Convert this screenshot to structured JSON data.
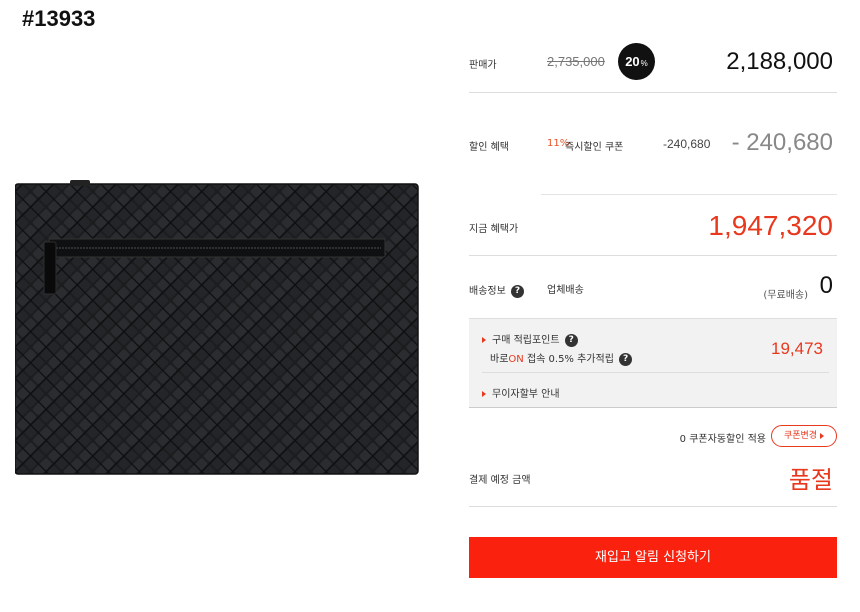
{
  "product": {
    "code": "#13933"
  },
  "price": {
    "label": "판매가",
    "original": "2,735,000",
    "discount_rate": "20",
    "discount_unit": "%",
    "sale_price": "2,188,000"
  },
  "discount": {
    "label": "할인 혜택",
    "coupon_rate": "11%",
    "coupon_name": "즉시할인 쿠폰",
    "amount_small": "-240,680",
    "amount_big": "- 240,680"
  },
  "benefit": {
    "label": "지금 혜택가",
    "price": "1,947,320"
  },
  "shipping": {
    "label": "배송정보",
    "type": "업체배송",
    "note": "(무료배송)",
    "fee": "0"
  },
  "points": {
    "title": "구매 적립포인트",
    "sub_prefix": "바로",
    "sub_on": "ON",
    "sub_suffix": " 접속 0.5% 추가적립",
    "value": "19,473",
    "installment": "무이자할부 안내"
  },
  "coupon": {
    "note": "0 쿠폰자동할인 적용",
    "button": "쿠폰변경"
  },
  "payment": {
    "label": "결제 예정 금액",
    "status": "품절"
  },
  "cta": {
    "label": "재입고 알림 신청하기"
  },
  "icons": {
    "help": "?"
  },
  "colors": {
    "accent": "#e8381d",
    "cta": "#fa220f",
    "badge": "#111111"
  }
}
